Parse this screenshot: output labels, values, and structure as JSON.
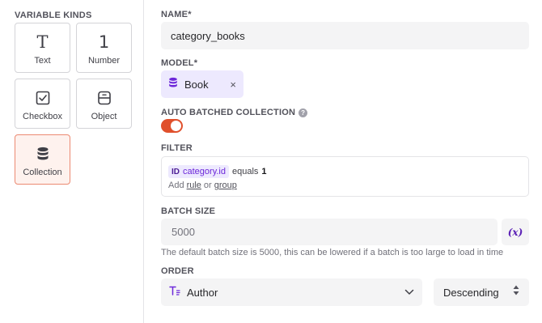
{
  "sidebar": {
    "title": "VARIABLE KINDS",
    "kinds": [
      {
        "label": "Text",
        "icon": "text-icon",
        "glyph": "T",
        "selected": false
      },
      {
        "label": "Number",
        "icon": "number-icon",
        "glyph": "1",
        "selected": false
      },
      {
        "label": "Checkbox",
        "icon": "checkbox-icon",
        "selected": false
      },
      {
        "label": "Object",
        "icon": "object-icon",
        "selected": false
      },
      {
        "label": "Collection",
        "icon": "database-icon",
        "selected": true
      }
    ]
  },
  "form": {
    "name_label": "NAME*",
    "name_value": "category_books",
    "model_label": "MODEL*",
    "model_value": "Book",
    "model_remove": "×",
    "auto_batched_label": "AUTO BATCHED COLLECTION",
    "auto_batched_help": "?",
    "auto_batched_on": true,
    "filter_label": "FILTER",
    "filter": {
      "id_tag": "ID",
      "field": "category.id",
      "operator": "equals",
      "value": "1",
      "add_text": "Add",
      "rule_link": "rule",
      "or_text": "or",
      "group_link": "group"
    },
    "batch_label": "BATCH SIZE",
    "batch_value": "5000",
    "variable_button": "(x)",
    "batch_hint": "The default batch size is 5000, this can be lowered if a batch is too large to load in time",
    "order_label": "ORDER",
    "order_field": "Author",
    "order_direction": "Descending"
  },
  "colors": {
    "accent": "#e0502c",
    "selected_card_bg": "#fef2ee",
    "selected_card_border": "#ec8a72",
    "chip_bg": "#ede9fe",
    "violet_text": "#6d28d9",
    "input_bg": "#f4f4f5"
  }
}
